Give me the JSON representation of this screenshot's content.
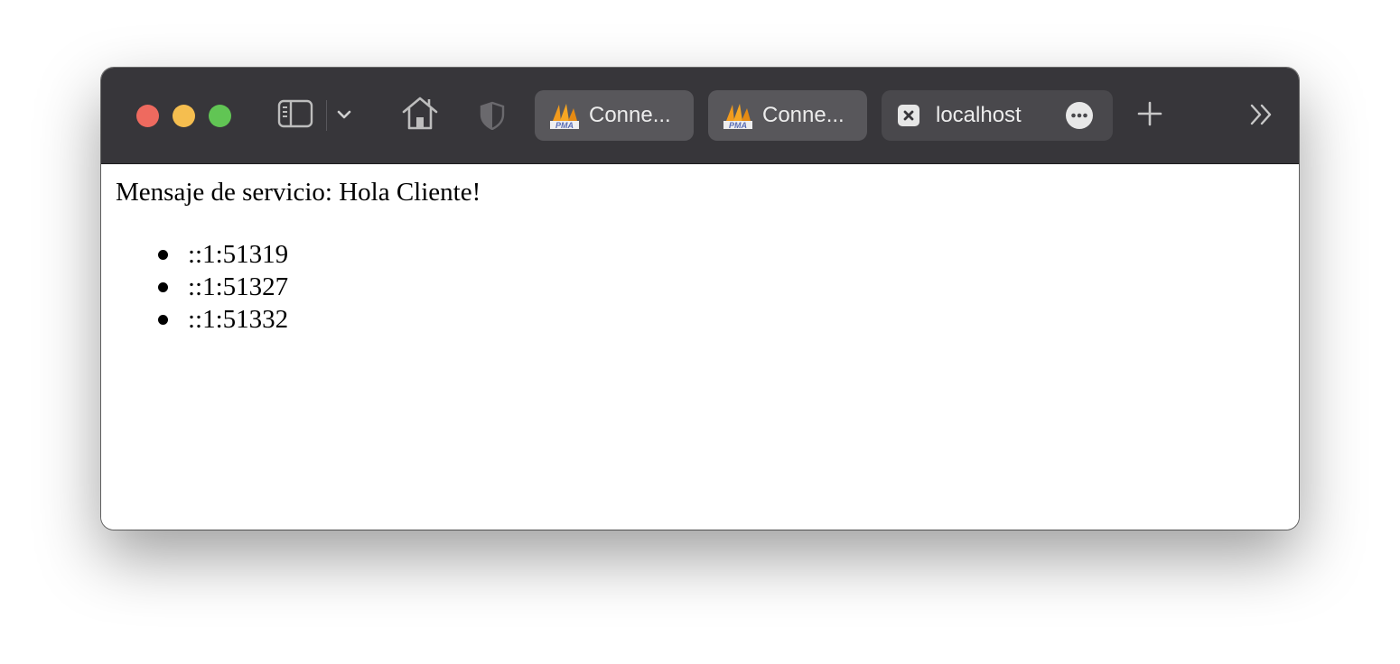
{
  "browser": {
    "tabs": [
      {
        "title": "Conne...",
        "icon": "phpmyadmin-icon",
        "state": "background"
      },
      {
        "title": "Conne...",
        "icon": "phpmyadmin-icon",
        "state": "background"
      },
      {
        "title": "localhost",
        "icon": "close-box-icon",
        "state": "active"
      }
    ],
    "colors": {
      "toolbar": "#37363a",
      "tab_inactive": "#58575b",
      "tab_active": "#49484c",
      "close": "#ee6a5f",
      "minimize": "#f5be4f",
      "maximize": "#61c554"
    }
  },
  "page": {
    "message": "Mensaje de servicio: Hola Cliente!",
    "clients": [
      "::1:51319",
      "::1:51327",
      "::1:51332"
    ]
  }
}
